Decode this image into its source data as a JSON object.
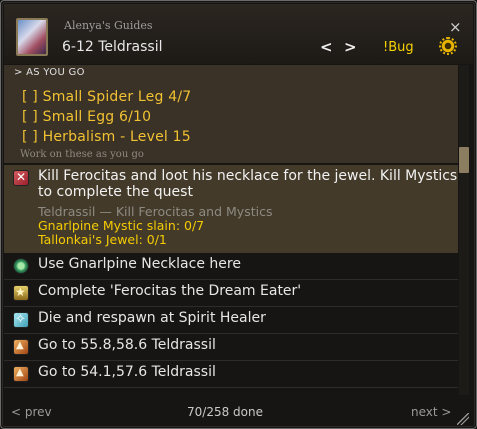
{
  "header": {
    "title": "Alenya's Guides",
    "guide_name": "6-12 Teldrassil",
    "prev_symbol": "<",
    "next_symbol": ">",
    "bug_label": "!Bug",
    "close_symbol": "×",
    "gear_icon": "gear-icon",
    "portrait_icon": "character-portrait-icon"
  },
  "as_you_go": {
    "header": "> AS YOU GO",
    "items": [
      "[ ] Small Spider Leg 4/7",
      "[ ] Small Egg 6/10",
      "[ ] Herbalism - Level 15"
    ],
    "footer": "Work on these as you go"
  },
  "steps": [
    {
      "icon": "kill-icon",
      "text": "Kill Ferocitas and loot his necklace for the jewel. Kill Mystics to complete the quest",
      "zone": "Teldrassil — Kill Ferocitas and Mystics",
      "goals": [
        "Gnarlpine Mystic slain: 0/7",
        "Tallonkai's Jewel: 0/1"
      ],
      "active": true
    },
    {
      "icon": "use-item-icon",
      "text": "Use Gnarlpine Necklace here"
    },
    {
      "icon": "trophy-icon",
      "text": "Complete 'Ferocitas the Dream Eater'"
    },
    {
      "icon": "spirit-healer-icon",
      "text": "Die and respawn at Spirit Healer"
    },
    {
      "icon": "goto-icon",
      "text": "Go to 55.8,58.6 Teldrassil"
    },
    {
      "icon": "goto-icon",
      "text": "Go to 54.1,57.6 Teldrassil"
    }
  ],
  "footer": {
    "prev_label": "< prev",
    "progress": "70/258 done",
    "next_label": "next >"
  },
  "colors": {
    "accent_yellow": "#f1c232",
    "goal_yellow": "#f5cc00",
    "active_row_bg": "#433a2a",
    "panel_bg": "#171513"
  }
}
